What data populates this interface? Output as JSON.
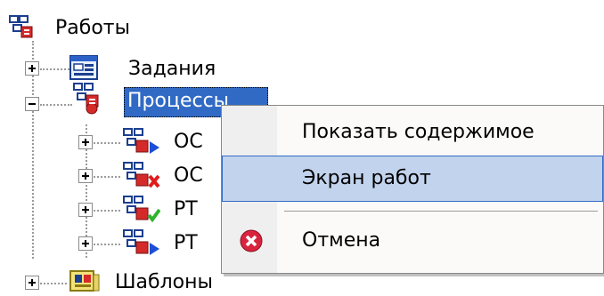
{
  "tree": {
    "root": "Работы",
    "items": [
      {
        "label": "Задания",
        "expander": "+"
      },
      {
        "label": "Процессы",
        "expander": "-"
      },
      {
        "label": "OC",
        "expander": "+",
        "status": "running"
      },
      {
        "label": "OC",
        "expander": "+",
        "status": "error"
      },
      {
        "label": "PT",
        "expander": "+",
        "status": "ok"
      },
      {
        "label": "PT",
        "expander": "+",
        "status": "running"
      },
      {
        "label": "Шаблоны",
        "expander": "+"
      }
    ]
  },
  "context_menu": {
    "items": [
      {
        "label": "Показать содержимое",
        "mnemonic": "с"
      },
      {
        "label": "Экран работ",
        "highlighted": true
      },
      {
        "label": "Отмена",
        "mnemonic": "О",
        "icon": "cancel-icon"
      }
    ]
  },
  "colors": {
    "selection": "#316ac5",
    "menu_hover": "#c2d3ed",
    "cancel_icon": "#d8243f",
    "status_running": "#1a4fd6",
    "status_error": "#e01b1b",
    "status_ok": "#2fb32f"
  }
}
